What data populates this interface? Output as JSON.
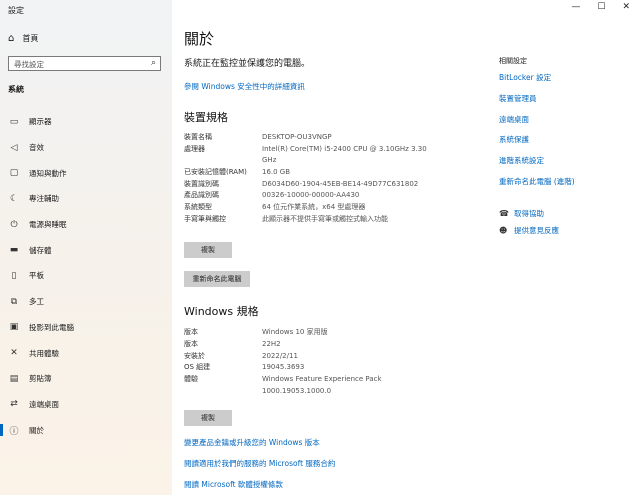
{
  "window": {
    "title": "設定",
    "minimize": "—",
    "maximize": "☐",
    "close": "✕"
  },
  "sidebar": {
    "home": "首頁",
    "search_placeholder": "尋找設定",
    "section": "系統",
    "items": [
      {
        "label": "顯示器",
        "icon": "display-icon"
      },
      {
        "label": "音效",
        "icon": "sound-icon"
      },
      {
        "label": "通知與動作",
        "icon": "notification-icon"
      },
      {
        "label": "專注輔助",
        "icon": "focus-icon"
      },
      {
        "label": "電源與睡眠",
        "icon": "power-icon"
      },
      {
        "label": "儲存體",
        "icon": "storage-icon"
      },
      {
        "label": "平板",
        "icon": "tablet-icon"
      },
      {
        "label": "多工",
        "icon": "multitask-icon"
      },
      {
        "label": "投影到此電腦",
        "icon": "project-icon"
      },
      {
        "label": "共用體驗",
        "icon": "shared-icon"
      },
      {
        "label": "剪貼簿",
        "icon": "clipboard-icon"
      },
      {
        "label": "遠端桌面",
        "icon": "remote-icon"
      },
      {
        "label": "關於",
        "icon": "info-icon",
        "active": true
      }
    ]
  },
  "main": {
    "title": "關於",
    "security_status": "系統正在監控並保護您的電腦。",
    "security_link": "參閱 Windows 安全性中的詳細資訊",
    "device_specs_heading": "裝置規格",
    "device_specs": [
      {
        "key": "裝置名稱",
        "value": "DESKTOP-OU3VNGP"
      },
      {
        "key": "處理器",
        "value": "Intel(R) Core(TM) i5-2400 CPU @ 3.10GHz   3.30 GHz"
      },
      {
        "key": "已安裝記憶體(RAM)",
        "value": "16.0 GB"
      },
      {
        "key": "裝置識別碼",
        "value": "D6034D60-1904-45EB-BE14-49D77C631802"
      },
      {
        "key": "產品識別碼",
        "value": "00326-10000-00000-AA430"
      },
      {
        "key": "系統類型",
        "value": "64 位元作業系統，x64 型處理器"
      },
      {
        "key": "手寫筆與觸控",
        "value": "此顯示器不提供手寫筆或觸控式輸入功能"
      }
    ],
    "copy_button": "複製",
    "rename_button": "重新命名此電腦",
    "windows_specs_heading": "Windows 規格",
    "windows_specs": [
      {
        "key": "版本",
        "value": "Windows 10 家用版"
      },
      {
        "key": "版本",
        "value": "22H2"
      },
      {
        "key": "安裝於",
        "value": "2022/2/11"
      },
      {
        "key": "OS 組建",
        "value": "19045.3693"
      },
      {
        "key": "體驗",
        "value": "Windows Feature Experience Pack 1000.19053.1000.0"
      }
    ],
    "copy_button2": "複製",
    "links": [
      "變更產品金鑰或升級您的 Windows 版本",
      "閱讀適用於我們的服務的 Microsoft 服務合約",
      "閱讀 Microsoft 軟體授權條款"
    ]
  },
  "related": {
    "heading": "相關設定",
    "items": [
      "BitLocker 設定",
      "裝置管理員",
      "遠端桌面",
      "系統保護",
      "進階系統設定",
      "重新命名此電腦 (進階)"
    ],
    "help": "取得協助",
    "feedback": "提供意見反應"
  }
}
